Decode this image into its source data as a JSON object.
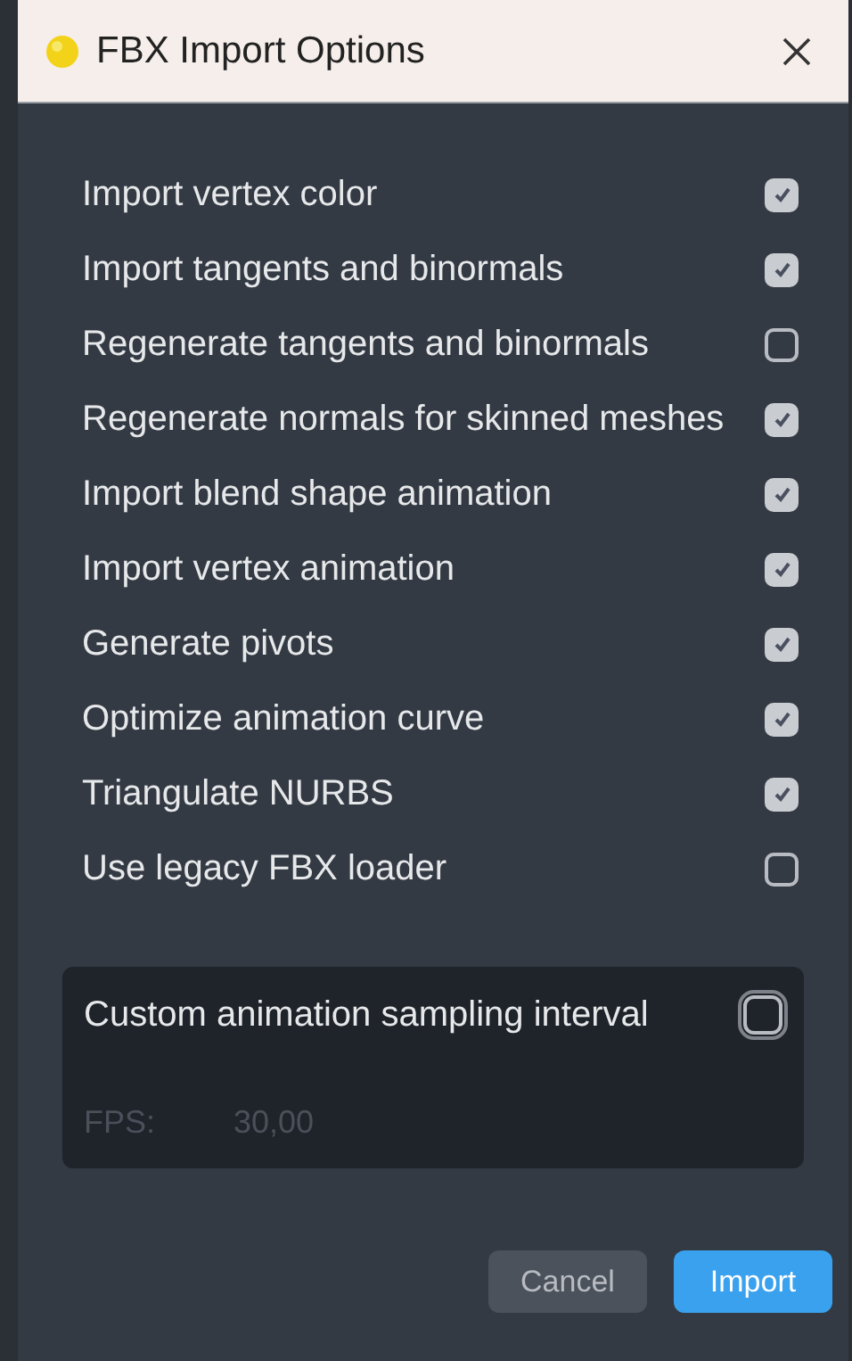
{
  "window": {
    "title": "FBX Import Options"
  },
  "options": [
    {
      "label": "Import vertex color",
      "checked": true
    },
    {
      "label": "Import tangents and binormals",
      "checked": true
    },
    {
      "label": "Regenerate tangents and binormals",
      "checked": false
    },
    {
      "label": "Regenerate normals for skinned meshes",
      "checked": true
    },
    {
      "label": "Import blend shape animation",
      "checked": true
    },
    {
      "label": "Import vertex animation",
      "checked": true
    },
    {
      "label": "Generate pivots",
      "checked": true
    },
    {
      "label": "Optimize animation curve",
      "checked": true
    },
    {
      "label": "Triangulate NURBS",
      "checked": true
    },
    {
      "label": "Use legacy FBX loader",
      "checked": false
    }
  ],
  "sampling": {
    "label": "Custom animation sampling interval",
    "checked": false,
    "fps_label": "FPS:",
    "fps_value": "30,00",
    "disabled": true
  },
  "buttons": [
    {
      "label": "Cancel",
      "kind": "secondary"
    },
    {
      "label": "Import",
      "kind": "primary"
    }
  ]
}
